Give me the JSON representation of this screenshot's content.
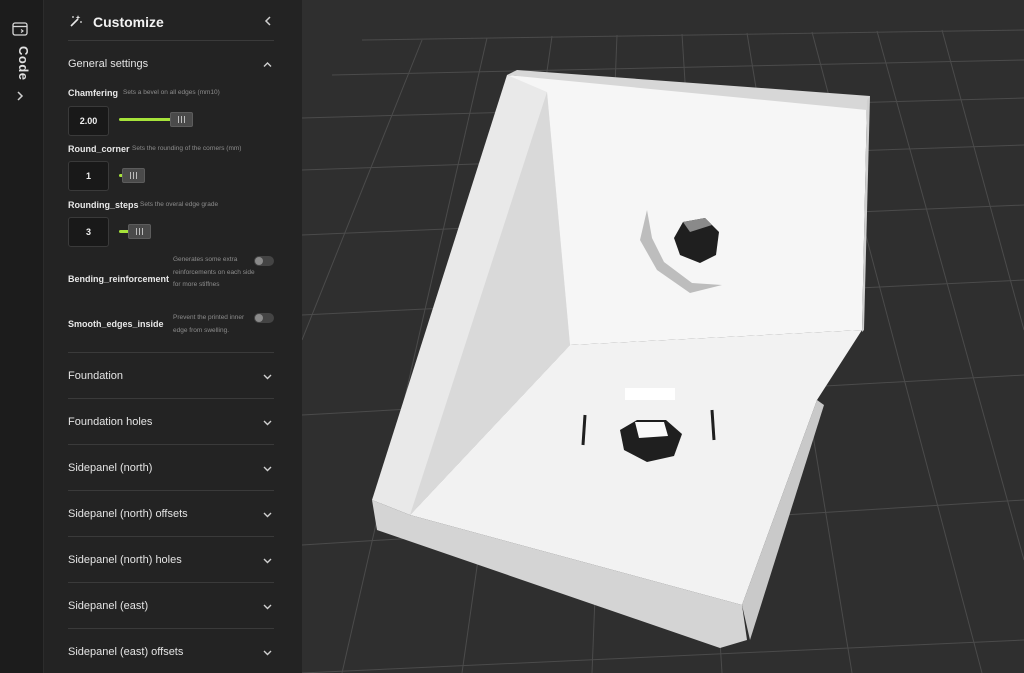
{
  "rail": {
    "label": "Code",
    "icon": "code-window-icon"
  },
  "panel": {
    "title": "Customize",
    "general": {
      "title": "General settings",
      "params": [
        {
          "name": "Chamfering",
          "desc": "Sets a bevel on all edges (mm10)",
          "value": "2.00",
          "fill": 0.72
        },
        {
          "name": "Round_corner",
          "desc": "Sets the rounding of the corners (mm)",
          "value": "1",
          "fill": 0.1
        },
        {
          "name": "Rounding_steps",
          "desc": "Sets the overal edge grade",
          "value": "3",
          "fill": 0.1
        }
      ],
      "toggles": [
        {
          "name": "Bending_reinforcement",
          "desc": "Generates some extra reinforcements on each side for more stiffnes",
          "on": false
        },
        {
          "name": "Smooth_edges_inside",
          "desc": "Prevent the printed inner edge from swelling.",
          "on": false
        }
      ]
    },
    "sections": [
      "Foundation",
      "Foundation holes",
      "Sidepanel (north)",
      "Sidepanel (north) offsets",
      "Sidepanel (north) holes",
      "Sidepanel (east)",
      "Sidepanel (east) offsets"
    ]
  },
  "colors": {
    "accent": "#a6e33a",
    "panel": "#232323",
    "rail": "#1c1c1c",
    "viewport": "#2f2f2f"
  }
}
